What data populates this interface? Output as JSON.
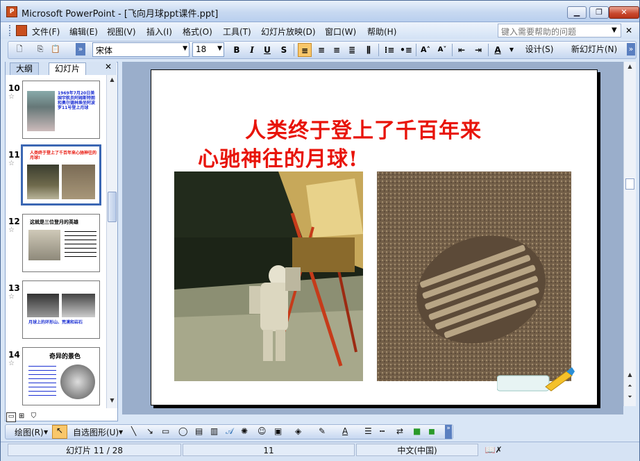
{
  "window": {
    "title": "Microsoft PowerPoint - [飞向月球ppt课件.ppt]",
    "app_icon": "P"
  },
  "menu": {
    "items": [
      "文件(F)",
      "编辑(E)",
      "视图(V)",
      "插入(I)",
      "格式(O)",
      "工具(T)",
      "幻灯片放映(D)",
      "窗口(W)",
      "帮助(H)"
    ],
    "help_placeholder": "键入需要帮助的问题"
  },
  "toolbar": {
    "font": "宋体",
    "size": "18",
    "bold": "B",
    "italic": "I",
    "underline": "U",
    "shadow": "S",
    "grow": "A˄",
    "shrink": "A˅",
    "fontcolor": "A",
    "design_label": "设计(S)",
    "new_slide_label": "新幻灯片(N)"
  },
  "panel": {
    "tab_outline": "大纲",
    "tab_slides": "幻灯片",
    "slides": [
      {
        "num": "10",
        "text": "1969年7月20日美国宇航员阿姆斯特朗和奥尔德林乘坐阿波罗11号登上月球"
      },
      {
        "num": "11",
        "text": "人类终于登上了千百年来心驰神往的月球!"
      },
      {
        "num": "12",
        "text": "这就是三位登月的英雄"
      },
      {
        "num": "13",
        "text": "月球上的环形山、荒漠和岩石"
      },
      {
        "num": "14",
        "text": "奇异的景色"
      }
    ]
  },
  "slide": {
    "title_line1": "人类终于登上了千百年来",
    "title_line2": "心驰神往的月球!"
  },
  "drawbar": {
    "draw_label": "绘图(R)",
    "autoshape_label": "自选图形(U)"
  },
  "status": {
    "slide_pos": "幻灯片 11 / 28",
    "design": "11",
    "language": "中文(中国)"
  },
  "colors": {
    "title_red": "#e8140a",
    "accent_blue": "#3b67b3"
  }
}
